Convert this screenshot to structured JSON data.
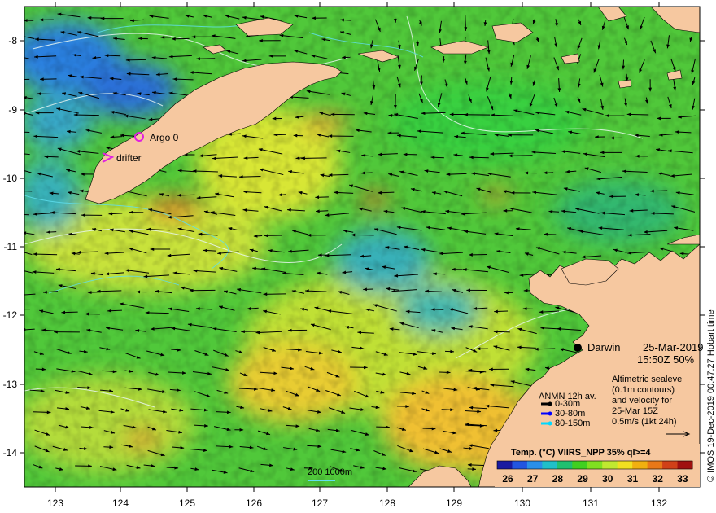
{
  "x_axis": {
    "ticks": [
      "123",
      "124",
      "125",
      "126",
      "127",
      "128",
      "129",
      "130",
      "131",
      "132"
    ]
  },
  "y_axis": {
    "ticks": [
      "-8",
      "-9",
      "-10",
      "-11",
      "-12",
      "-13",
      "-14"
    ]
  },
  "labels": {
    "argo": "Argo 0",
    "drifter": "drifter",
    "city": "Darwin",
    "date": "25-Mar-2019",
    "time_pct": "15:50Z  50%",
    "credit": "© IMOS 19-Dec-2019 00:47:27 Hobart time"
  },
  "legend_anmn": {
    "title": "ANMN 12h av.",
    "items": [
      {
        "text": "0-30m",
        "color": "#000000"
      },
      {
        "text": "30-80m",
        "color": "#0000ff"
      },
      {
        "text": "80-150m",
        "color": "#00d8ff"
      }
    ]
  },
  "legend_altimetry": {
    "lines": [
      "Altimetric sealevel",
      "(0.1m contours)",
      "and velocity for",
      "25-Mar 15Z",
      "0.5m/s (1kt 24h)"
    ]
  },
  "scale": {
    "text": "200  1000m"
  },
  "colorbar": {
    "title": "Temp. (°C) VIIRS_NPP 35% ql>=4",
    "ticks": [
      "26",
      "27",
      "28",
      "29",
      "30",
      "31",
      "32",
      "33"
    ],
    "colors": [
      "#1a1aa0",
      "#2255e0",
      "#2a8fe8",
      "#20c0c8",
      "#20c070",
      "#40d020",
      "#80e020",
      "#c0e830",
      "#f0e020",
      "#f0b010",
      "#e87818",
      "#d04018",
      "#a01010"
    ]
  },
  "palette": {
    "land": "#f6c8a0",
    "sea_green": "#4cc835",
    "sea_yellow": "#c8e23a",
    "sea_blue": "#1a5fd0",
    "sea_cyan": "#35b8c0",
    "sea_orange": "#eeb030"
  }
}
